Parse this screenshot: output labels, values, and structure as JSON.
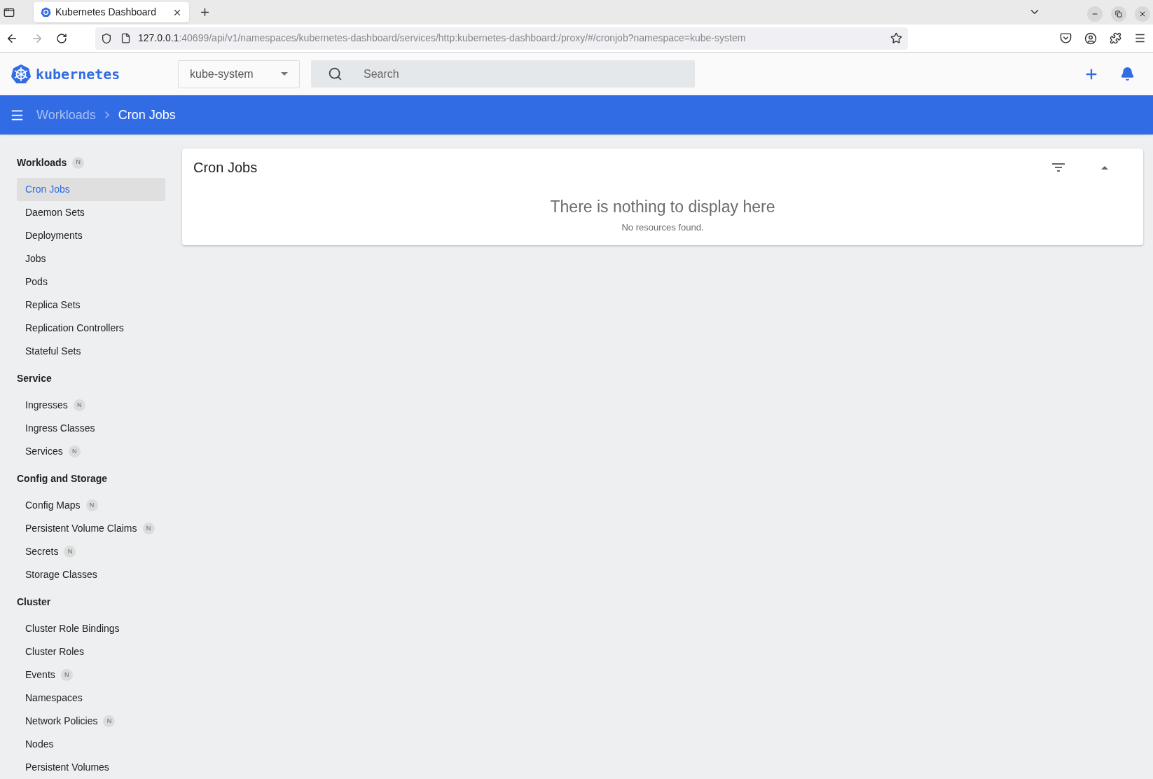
{
  "browser": {
    "tab_title": "Kubernetes Dashboard",
    "url_host": "127.0.0.1",
    "url_rest": ":40699/api/v1/namespaces/kubernetes-dashboard/services/http:kubernetes-dashboard:/proxy/#/cronjob?namespace=kube-system"
  },
  "header": {
    "logo": "kubernetes",
    "namespace": "kube-system",
    "search_placeholder": "Search"
  },
  "breadcrumb": [
    "Workloads",
    "Cron Jobs"
  ],
  "sidebar": [
    {
      "title": "Workloads",
      "badge": "N",
      "items": [
        {
          "label": "Cron Jobs",
          "selected": true
        },
        {
          "label": "Daemon Sets",
          "selected": false
        },
        {
          "label": "Deployments",
          "selected": false
        },
        {
          "label": "Jobs",
          "selected": false
        },
        {
          "label": "Pods",
          "selected": false
        },
        {
          "label": "Replica Sets",
          "selected": false
        },
        {
          "label": "Replication Controllers",
          "selected": false
        },
        {
          "label": "Stateful Sets",
          "selected": false
        }
      ]
    },
    {
      "title": "Service",
      "items": [
        {
          "label": "Ingresses",
          "badge": "N",
          "selected": false
        },
        {
          "label": "Ingress Classes",
          "selected": false
        },
        {
          "label": "Services",
          "badge": "N",
          "selected": false
        }
      ]
    },
    {
      "title": "Config and Storage",
      "items": [
        {
          "label": "Config Maps",
          "badge": "N",
          "selected": false
        },
        {
          "label": "Persistent Volume Claims",
          "badge": "N",
          "selected": false
        },
        {
          "label": "Secrets",
          "badge": "N",
          "selected": false
        },
        {
          "label": "Storage Classes",
          "selected": false
        }
      ]
    },
    {
      "title": "Cluster",
      "items": [
        {
          "label": "Cluster Role Bindings",
          "selected": false
        },
        {
          "label": "Cluster Roles",
          "selected": false
        },
        {
          "label": "Events",
          "badge": "N",
          "selected": false
        },
        {
          "label": "Namespaces",
          "selected": false
        },
        {
          "label": "Network Policies",
          "badge": "N",
          "selected": false
        },
        {
          "label": "Nodes",
          "selected": false
        },
        {
          "label": "Persistent Volumes",
          "selected": false
        }
      ]
    }
  ],
  "card": {
    "title": "Cron Jobs",
    "empty_title": "There is nothing to display here",
    "empty_subtitle": "No resources found."
  }
}
